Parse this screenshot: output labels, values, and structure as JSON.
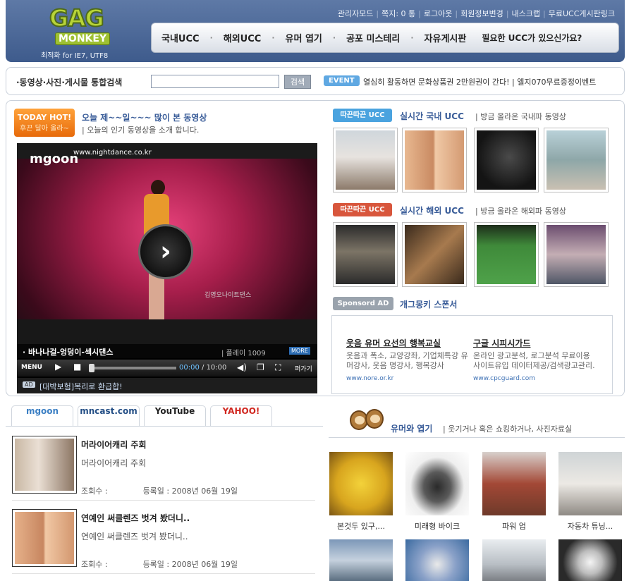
{
  "header": {
    "logo_top": "GAG",
    "logo_bottom": "MONKEY",
    "logo_sub": "최적화 for IE7, UTF8",
    "util_links": [
      "관리자모드",
      "쪽지: 0 통",
      "로그아웃",
      "회원정보변경",
      "내스크랩",
      "무료UCC게시판링크"
    ],
    "nav": [
      "국내UCC",
      "해외UCC",
      "유머 엽기",
      "공포 미스테리",
      "자유게시판"
    ],
    "nav_extra": "필요한 UCC가 있으신가요?"
  },
  "search": {
    "label": "·동영상·사진·게시물 통합검색",
    "placeholder": "",
    "value": "",
    "button": "검색",
    "event_badge": "EVENT",
    "event_text": "열심히 활동하면 문화상품권 2만원권이 간다! | 엘지070무료증정이벤트"
  },
  "today_hot": {
    "badge_line1": "TODAY HOT!",
    "badge_line2": "후끈 달아 올라~",
    "title": "오늘 제~~일~~~ 많이 본 동영상",
    "subtitle": "| 오늘의 인기 동영상을 소개 합니다."
  },
  "player": {
    "brand": "mgoon",
    "url": "www.nightdance.co.kr",
    "overlay_caption": "김영오나이트댄스",
    "video_title": "· 바나나걸-엉덩이-섹시댄스",
    "play_count": "| 플레이 1009",
    "more": "MORE",
    "menu": "MENU",
    "time_current": "00:00",
    "time_total": "/ 10:00",
    "embed": "퍼가기",
    "ad_tag": "AD",
    "ad_text": "[대박보험]복리로 환급합!"
  },
  "domestic": {
    "badge": "따끈따끈 UCC",
    "title": "실시간 국내 UCC",
    "subtitle": "| 방금 올라온 국내파 동영상"
  },
  "overseas": {
    "badge": "따끈따끈 UCC",
    "title": "실시간 해외 UCC",
    "subtitle": "| 방금 올라온 해외파 동영상"
  },
  "sponsor": {
    "badge": "Sponsord AD",
    "title": "개그몽키 스폰서",
    "ads": [
      {
        "title": "웃음 유머 요선의 행복교실",
        "desc": "웃음과 폭소, 교양강좌, 기업체특강 유머강사, 웃음 명강사, 행복강사",
        "url": "www.nore.or.kr"
      },
      {
        "title": "구글 시피시가드",
        "desc": "온라인 광고분석, 로그분석 무료이용 사이트유입 데이터제공/검색광고관리.",
        "url": "www.cpcguard.com"
      }
    ]
  },
  "tabs": [
    "mgoon",
    "mncast.com",
    "YouTube",
    "YAHOO!"
  ],
  "list": [
    {
      "title": "머라이어캐리 주회",
      "desc": "머라이어캐리 주회",
      "views_label": "조회수 :",
      "date": "등록일 : 2008년 06월 19일"
    },
    {
      "title": "연예인 써클렌즈 벗겨 봤더니..",
      "desc": "연예인 써클렌즈 벗겨 봤더니..",
      "views_label": "조회수 :",
      "date": "등록일 : 2008년 06월 19일"
    }
  ],
  "humor": {
    "title": "유머와 엽기",
    "subtitle": "| 웃기거나 혹은 쇼킹하거나, 사진자료실",
    "items": [
      "본것두 있구,...",
      "미래형 바이크",
      "파워 업",
      "자동차 튜닝..."
    ]
  },
  "colors": {
    "header_bg": "#4a6696",
    "link_blue": "#3a5d99",
    "badge_blue": "#4aa3df",
    "badge_red": "#d8563c",
    "hot_orange": "#f08420"
  }
}
